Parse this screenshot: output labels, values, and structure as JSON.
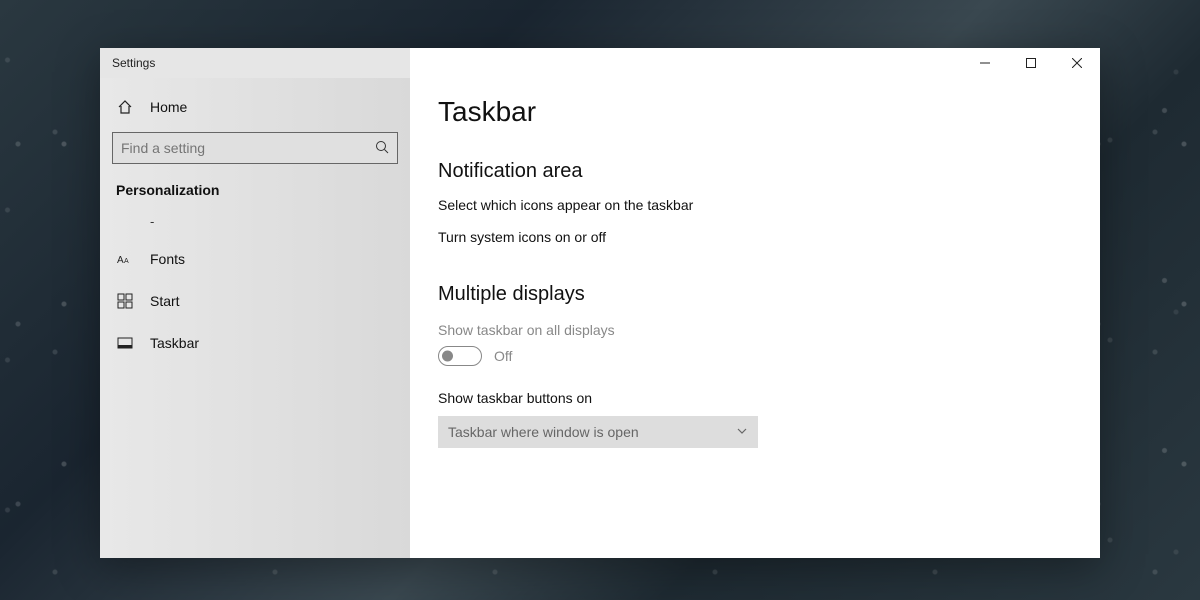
{
  "window": {
    "title": "Settings"
  },
  "sidebar": {
    "home_label": "Home",
    "search_placeholder": "Find a setting",
    "category": "Personalization",
    "items": [
      {
        "label": "-"
      },
      {
        "label": "Fonts"
      },
      {
        "label": "Start"
      },
      {
        "label": "Taskbar"
      }
    ]
  },
  "main": {
    "page_title": "Taskbar",
    "sections": {
      "notification": {
        "title": "Notification area",
        "links": [
          "Select which icons appear on the taskbar",
          "Turn system icons on or off"
        ]
      },
      "displays": {
        "title": "Multiple displays",
        "show_all_label": "Show taskbar on all displays",
        "show_all_state": "Off",
        "buttons_label": "Show taskbar buttons on",
        "buttons_value": "Taskbar where window is open"
      }
    }
  }
}
